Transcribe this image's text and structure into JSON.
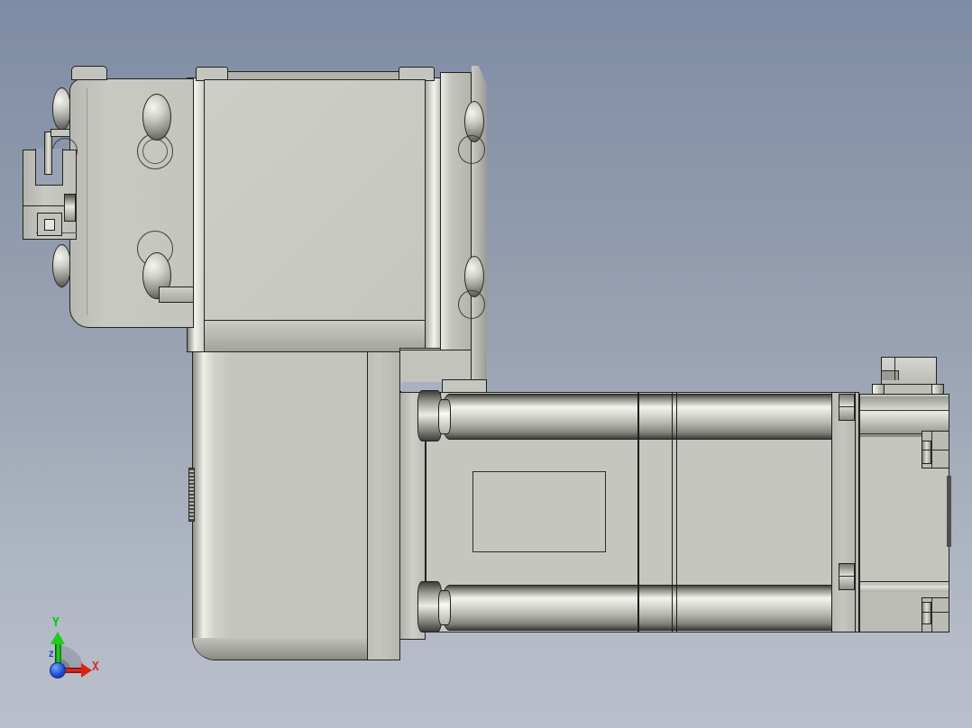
{
  "viewport": {
    "kind": "3d-cad-viewport",
    "background_gradient_top": "#7E8CA5",
    "background_gradient_mid": "#9AA3B3",
    "background_gradient_bottom": "#BAC0CB"
  },
  "model": {
    "name": "right-angle-gearmotor-linear-actuator-assembly",
    "surface_color": "#C6C6C0",
    "outline_color": "#23231F",
    "highlight_color": "#F2F2EC",
    "shadow_color": "#8E8E88",
    "parts": [
      "sensor-bracket",
      "gearbox-housing-block",
      "motor-mount-plate",
      "flange-plate",
      "dome-head-screws",
      "vertical-gearbox-body",
      "actuator-housing",
      "guide-rod-top",
      "guide-rod-bottom",
      "end-bolts",
      "face-label-recess",
      "shaft-coupling",
      "motor-body",
      "motor-connector"
    ]
  },
  "axis_triad": {
    "x": {
      "label": "X",
      "color": "#CC3333"
    },
    "y": {
      "label": "Y",
      "color": "#00CC00"
    },
    "z": {
      "label": "Z",
      "color": "#2238C8"
    },
    "origin_color": "#2050D8",
    "rotation_arc_color": "#9AA0AB"
  }
}
